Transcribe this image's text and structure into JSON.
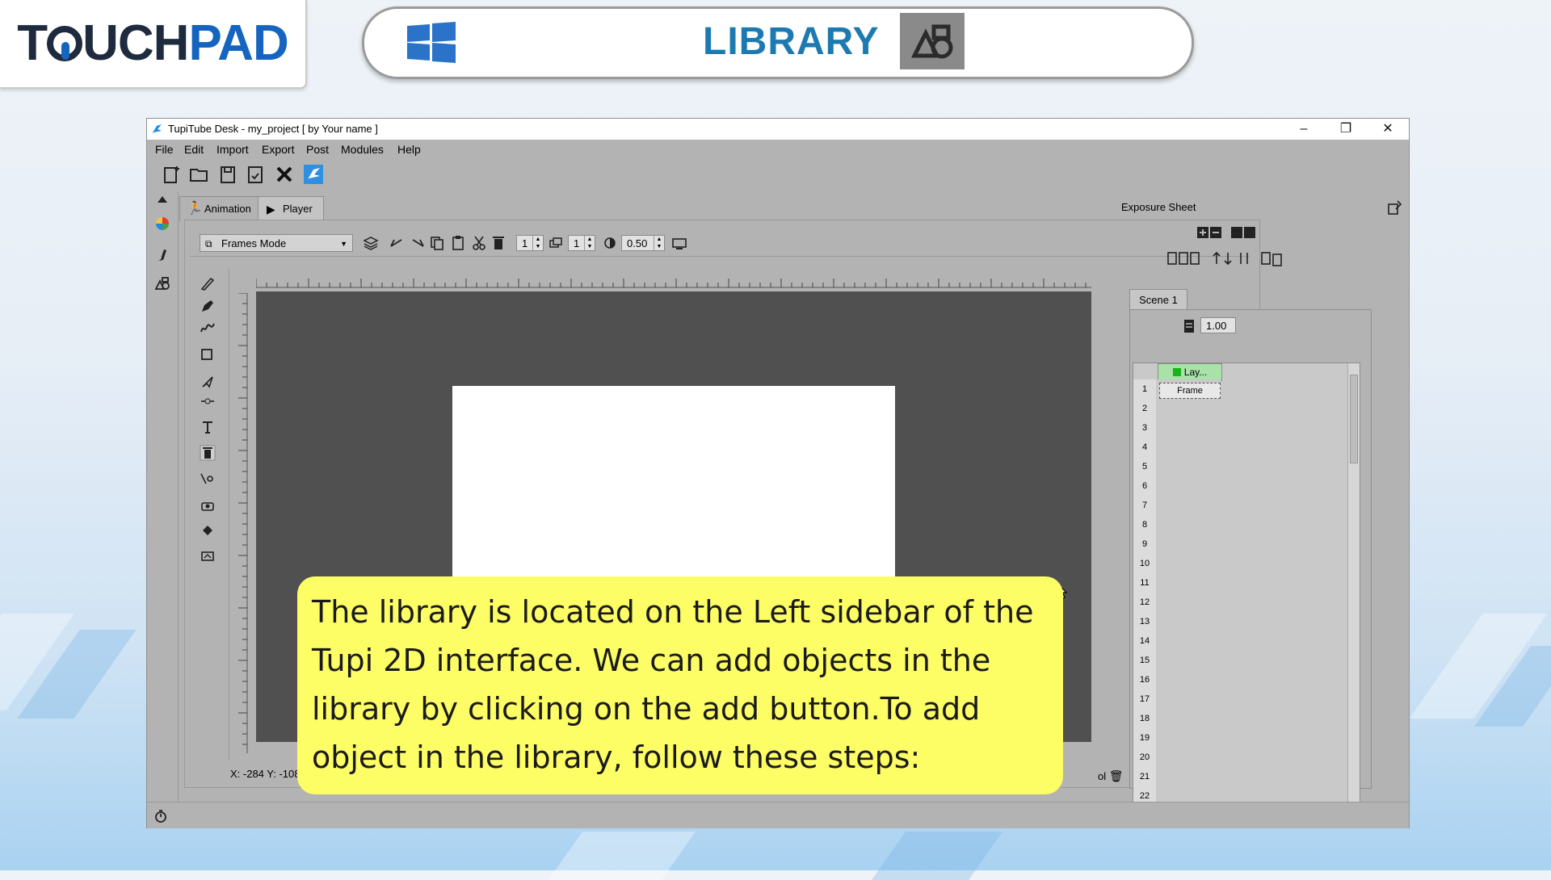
{
  "banner": {
    "logo_part1": "T",
    "logo_part2": "UCH",
    "logo_part3": "PAD",
    "title": "LIBRARY",
    "os_icon": "windows-logo-icon",
    "section_icon": "library-shapes-icon"
  },
  "window": {
    "title": "TupiTube Desk - my_project [ by Your name ]",
    "minimize": "–",
    "restore": "❐",
    "close": "✕"
  },
  "menu": [
    "File",
    "Edit",
    "Import",
    "Export",
    "Post",
    "Modules",
    "Help"
  ],
  "tabs": {
    "animation": "Animation",
    "player": "Player"
  },
  "toolbar": {
    "mode": "Frames Mode",
    "spin1": "1",
    "spin2": "1",
    "opacity": "0.50"
  },
  "status": {
    "coords": "X: -284 Y: -108",
    "tool": "ol"
  },
  "exposure": {
    "title": "Exposure Sheet",
    "scene_tab": "Scene 1",
    "fps": "1.00",
    "layer_name": "Lay...",
    "frame_label": "Frame",
    "rows": [
      "1",
      "2",
      "3",
      "4",
      "5",
      "6",
      "7",
      "8",
      "9",
      "10",
      "11",
      "12",
      "13",
      "14",
      "15",
      "16",
      "17",
      "18",
      "19",
      "20",
      "21",
      "22"
    ]
  },
  "callout": {
    "line1": "The library is located on the Left sidebar of the",
    "line2": "Tupi 2D interface. We can add objects in the",
    "line3": "library by clicking on the add button.To add",
    "line4": "object in the library, follow these steps:"
  },
  "colors": {
    "brand_blue": "#1565c0",
    "title_blue": "#1d7ab1",
    "callout_yellow": "#fdfd66",
    "canvas_gray": "#505050"
  }
}
